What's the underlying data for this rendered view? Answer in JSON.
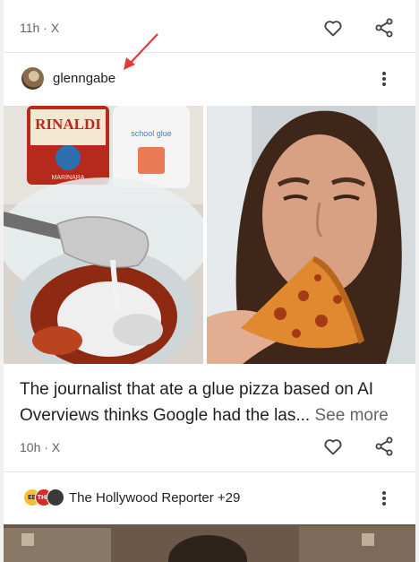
{
  "top_card": {
    "meta": "11h · X"
  },
  "story": {
    "source_name": "glenngabe",
    "headline": "The journalist that ate a glue pizza based on AI Overviews thinks Google had the las...",
    "see_more": "See more",
    "meta": "10h · X",
    "left_image_label": "RINALDI",
    "left_image_label2": "MARINARA",
    "left_image_bottle": "school glue"
  },
  "next_card": {
    "publisher": "The Hollywood Reporter +29",
    "logo_a": "EB",
    "logo_b": "THR"
  },
  "icons": {
    "like": "heart-icon",
    "share": "share-icon",
    "more": "more-vert-icon",
    "annotation": "red-arrow-icon"
  },
  "colors": {
    "annotation": "#e53935",
    "meta_text": "#5f6368",
    "divider": "#e4e4e4"
  }
}
